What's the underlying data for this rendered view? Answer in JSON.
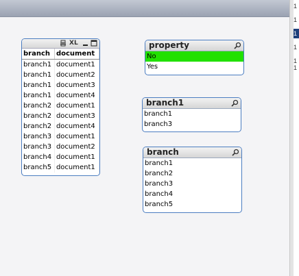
{
  "table_box": {
    "icons": [
      "print-icon",
      "xl-icon",
      "minimize-icon",
      "maximize-icon"
    ],
    "xl_label": "XL",
    "columns": [
      "branch",
      "document"
    ],
    "rows": [
      [
        "branch1",
        "document1"
      ],
      [
        "branch1",
        "document2"
      ],
      [
        "branch1",
        "document3"
      ],
      [
        "branch1",
        "document4"
      ],
      [
        "branch2",
        "document1"
      ],
      [
        "branch2",
        "document3"
      ],
      [
        "branch2",
        "document4"
      ],
      [
        "branch3",
        "document1"
      ],
      [
        "branch3",
        "document2"
      ],
      [
        "branch4",
        "document1"
      ],
      [
        "branch5",
        "document1"
      ]
    ]
  },
  "listboxes": [
    {
      "title": "property",
      "items": [
        {
          "label": "No",
          "selected": true
        },
        {
          "label": "Yes",
          "selected": false
        }
      ]
    },
    {
      "title": "branch1",
      "items": [
        {
          "label": "branch1",
          "selected": false
        },
        {
          "label": "branch3",
          "selected": false
        }
      ]
    },
    {
      "title": "branch",
      "items": [
        {
          "label": "branch1",
          "selected": false
        },
        {
          "label": "branch2",
          "selected": false
        },
        {
          "label": "branch3",
          "selected": false
        },
        {
          "label": "branch4",
          "selected": false
        },
        {
          "label": "branch5",
          "selected": false
        }
      ]
    }
  ],
  "right_strip_numbers": [
    "1",
    "1",
    "1",
    "1",
    "1",
    "1"
  ],
  "colors": {
    "selected": "#22e000",
    "border": "#4a7cc0"
  }
}
